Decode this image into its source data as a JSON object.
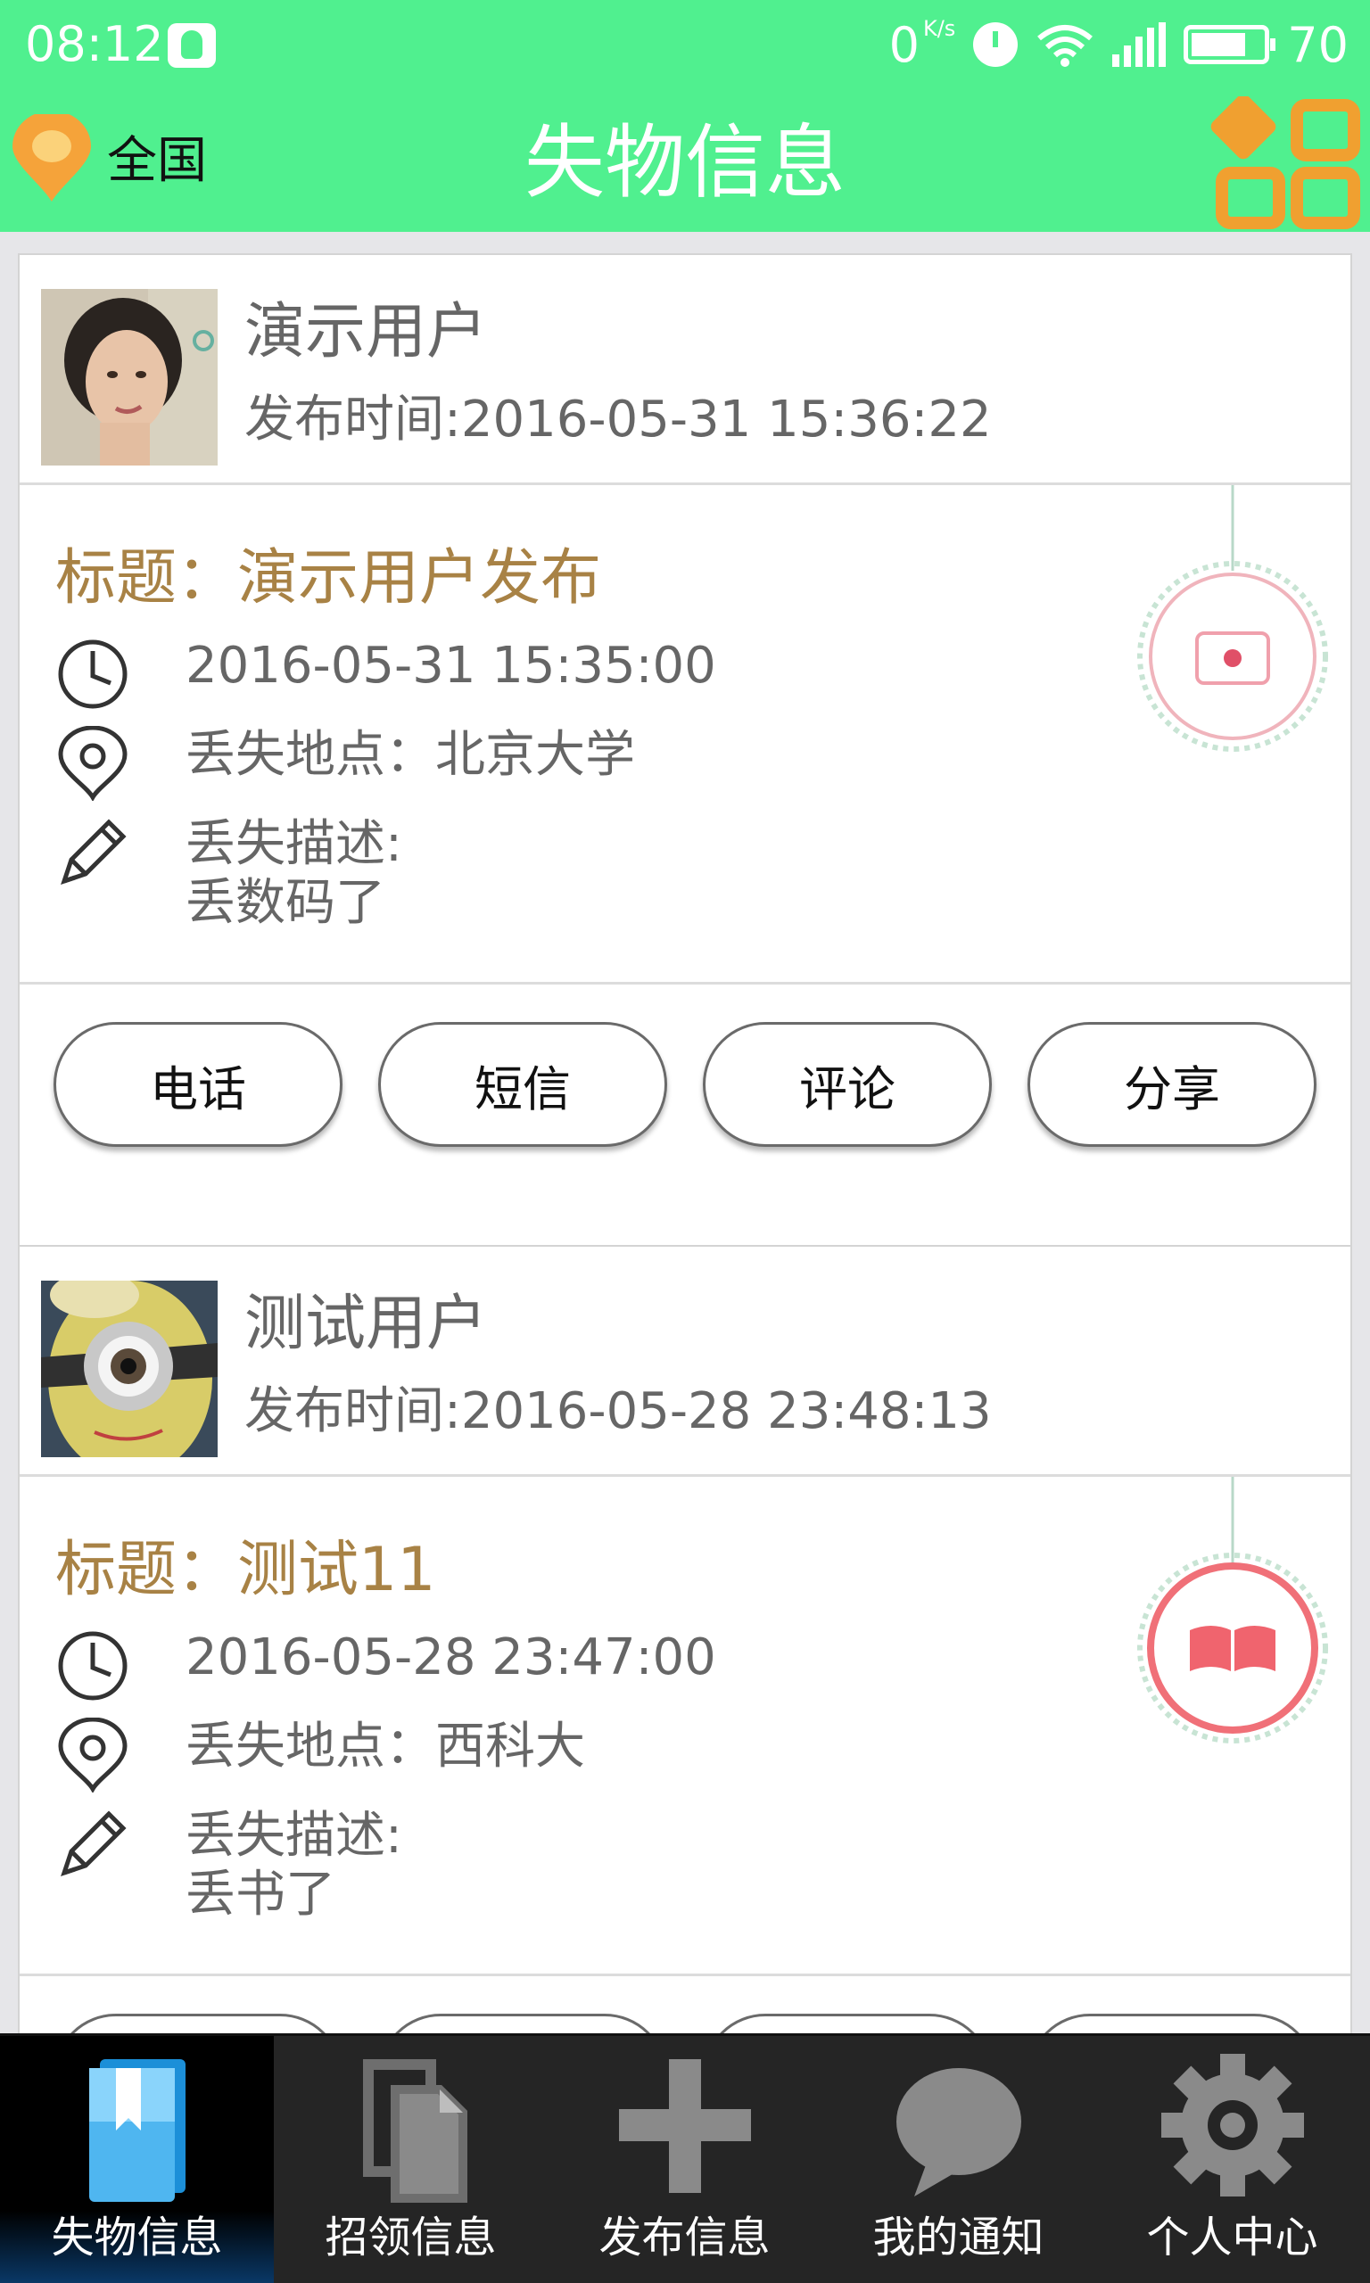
{
  "status_bar": {
    "time": "08:12",
    "net_speed": "0",
    "net_unit": "K/s",
    "network": "4G",
    "battery": "70"
  },
  "header": {
    "region": "全国",
    "title": "失物信息"
  },
  "posts": [
    {
      "username": "演示用户",
      "posted": "发布时间:2016-05-31 15:36:22",
      "title": "标题：演示用户发布",
      "date": "2016-05-31 15:35:00",
      "place": "丢失地点：北京大学",
      "desc_label": "丢失描述:",
      "desc": "丢数码了",
      "category_icon": "camera-icon",
      "buttons": [
        "电话",
        "短信",
        "评论",
        "分享"
      ]
    },
    {
      "username": "测试用户",
      "posted": "发布时间:2016-05-28 23:48:13",
      "title": "标题：测试11",
      "date": "2016-05-28 23:47:00",
      "place": "丢失地点：西科大",
      "desc_label": "丢失描述:",
      "desc": "丢书了",
      "category_icon": "book-icon",
      "buttons": [
        "电话",
        "短信",
        "评论",
        "分享"
      ]
    }
  ],
  "bottom_nav": [
    {
      "label": "失物信息",
      "icon": "book-icon",
      "active": true
    },
    {
      "label": "招领信息",
      "icon": "documents-icon",
      "active": false
    },
    {
      "label": "发布信息",
      "icon": "plus-icon",
      "active": false
    },
    {
      "label": "我的通知",
      "icon": "chat-bubble-icon",
      "active": false
    },
    {
      "label": "个人中心",
      "icon": "gear-icon",
      "active": false
    }
  ],
  "colors": {
    "header_green": "#50f08f",
    "title_gold": "#a88245",
    "badge_red": "#f0646e",
    "pin_orange": "#f5a33a"
  }
}
